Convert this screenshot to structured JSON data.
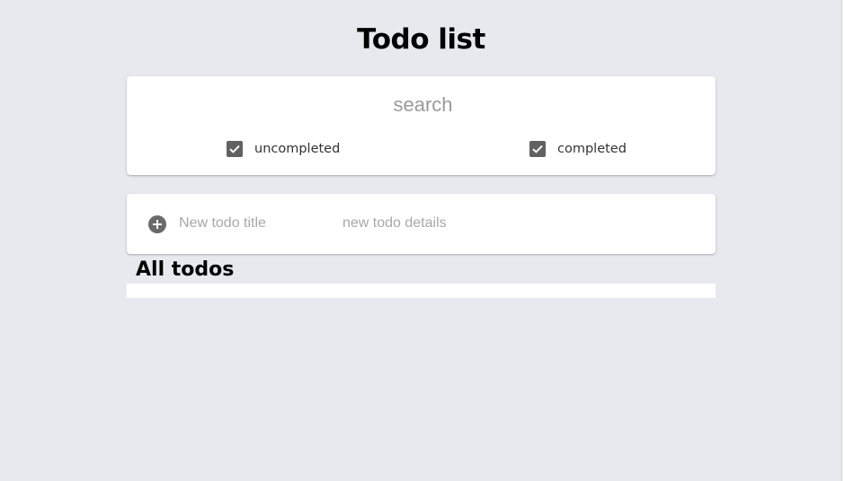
{
  "page": {
    "title": "Todo list"
  },
  "search": {
    "placeholder": "search",
    "value": ""
  },
  "filters": [
    {
      "label": "uncompleted",
      "checked": true
    },
    {
      "label": "completed",
      "checked": true
    }
  ],
  "new_todo": {
    "title_placeholder": "New todo title",
    "details_placeholder": "new todo details",
    "add_icon": "add-circle-icon"
  },
  "list": {
    "heading": "All todos",
    "items": []
  },
  "colors": {
    "background": "#e7e9ee",
    "card": "#ffffff",
    "checkbox": "#616161",
    "add_icon": "#6a6a6a"
  }
}
